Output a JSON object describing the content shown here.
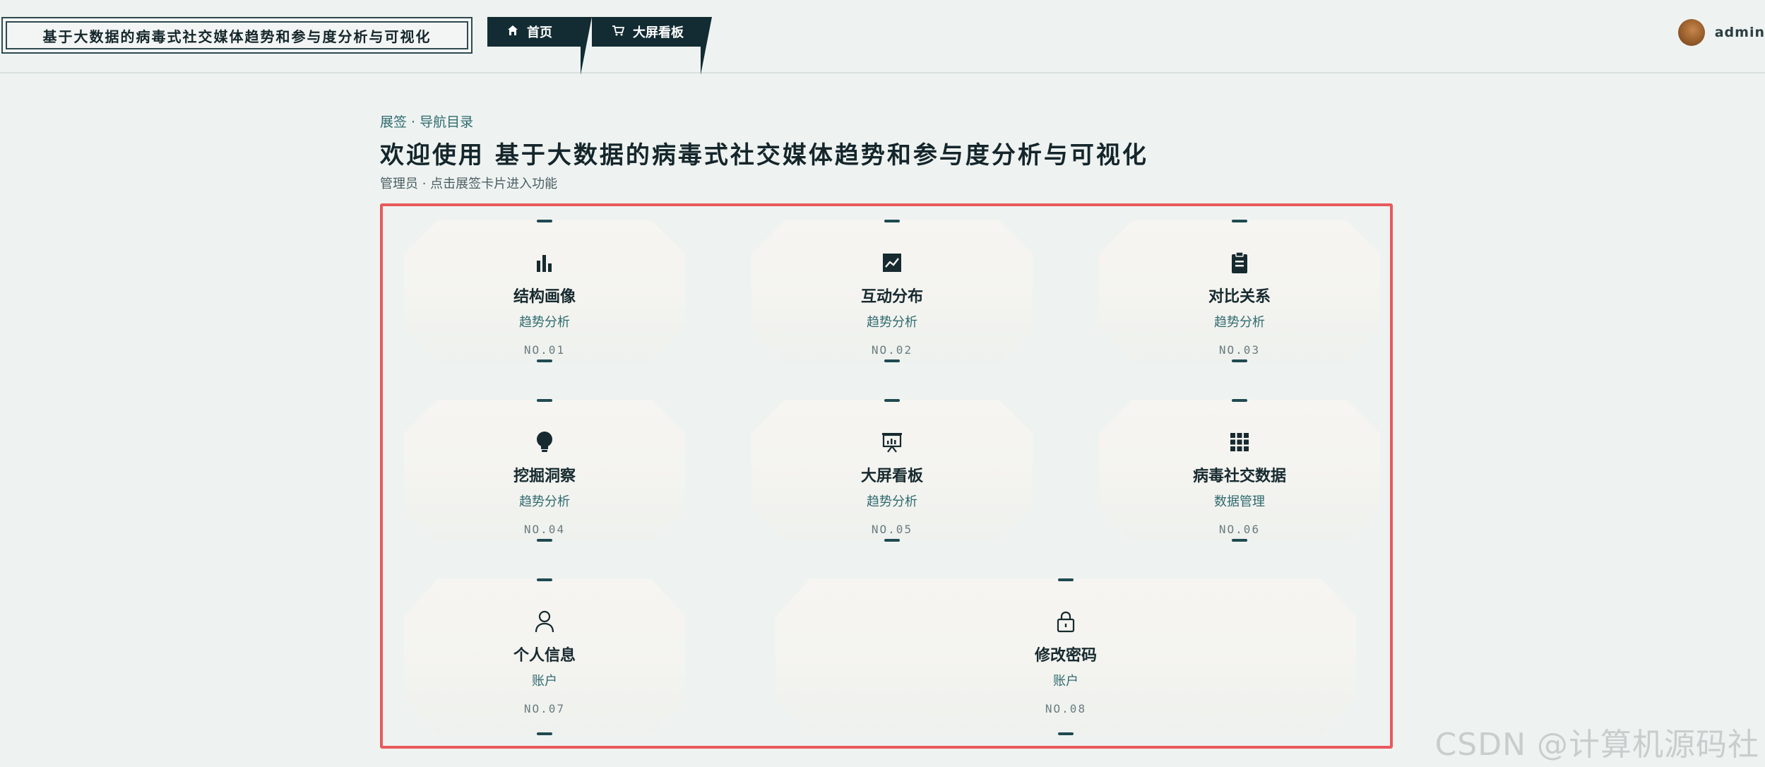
{
  "header": {
    "app_title": "基于大数据的病毒式社交媒体趋势和参与度分析与可视化",
    "nav": [
      {
        "label": "首页",
        "icon": "home-icon"
      },
      {
        "label": "大屏看板",
        "icon": "cart-icon"
      }
    ],
    "user": {
      "name": "admin",
      "avatar": "avatar-image"
    }
  },
  "welcome": {
    "breadcrumb": "展签 · 导航目录",
    "title": "欢迎使用  基于大数据的病毒式社交媒体趋势和参与度分析与可视化",
    "subtitle": "管理员 · 点击展签卡片进入功能"
  },
  "cards": [
    {
      "title": "结构画像",
      "category": "趋势分析",
      "number": "NO.01",
      "icon": "bar-chart-icon"
    },
    {
      "title": "互动分布",
      "category": "趋势分析",
      "number": "NO.02",
      "icon": "line-chart-icon"
    },
    {
      "title": "对比关系",
      "category": "趋势分析",
      "number": "NO.03",
      "icon": "clipboard-icon"
    },
    {
      "title": "挖掘洞察",
      "category": "趋势分析",
      "number": "NO.04",
      "icon": "lightbulb-icon"
    },
    {
      "title": "大屏看板",
      "category": "趋势分析",
      "number": "NO.05",
      "icon": "presentation-icon"
    },
    {
      "title": "病毒社交数据",
      "category": "数据管理",
      "number": "NO.06",
      "icon": "grid-icon"
    },
    {
      "title": "个人信息",
      "category": "账户",
      "number": "NO.07",
      "icon": "user-icon"
    },
    {
      "title": "修改密码",
      "category": "账户",
      "number": "NO.08",
      "icon": "lock-icon"
    }
  ],
  "watermark": "CSDN @计算机源码社",
  "colors": {
    "accent": "#132c33",
    "frame": "#e8595c",
    "background": "#eef3f1"
  }
}
